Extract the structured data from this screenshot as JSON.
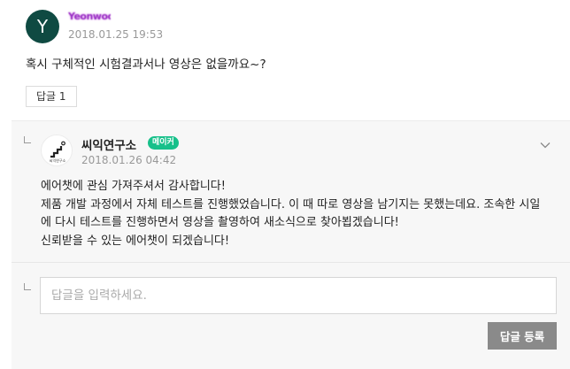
{
  "comment": {
    "avatar_letter": "Y",
    "author_name": "Yeonwoo",
    "date": "2018.01.25 19:53",
    "text": "혹시 구체적인 시험결과서나 영상은 없을까요~?",
    "reply_button_label": "답글 1"
  },
  "reply": {
    "author_name": "씨익연구소",
    "badge": "메이커",
    "date": "2018.01.26 04:42",
    "logo_caption": "씨익연구소",
    "lines": [
      "에어챗에 관심 가져주셔서 감사합니다!",
      "제품 개발 과정에서 자체 테스트를 진행했었습니다. 이 때 따로 영상을 남기지는 못했는데요. 조속한 시일",
      "에 다시 테스트를 진행하면서 영상을 촬영하여 새소식으로 찾아뵙겠습니다!",
      "신뢰받을 수 있는 에어챗이 되겠습니다!"
    ]
  },
  "reply_form": {
    "placeholder": "답글을 입력하세요.",
    "value": "",
    "submit_label": "답글 등록"
  },
  "colors": {
    "avatar_bg": "#0f4a42",
    "maker_badge": "#17c08a",
    "submit_button": "#8a8a8a",
    "reply_area_bg": "#f7f7f7"
  }
}
